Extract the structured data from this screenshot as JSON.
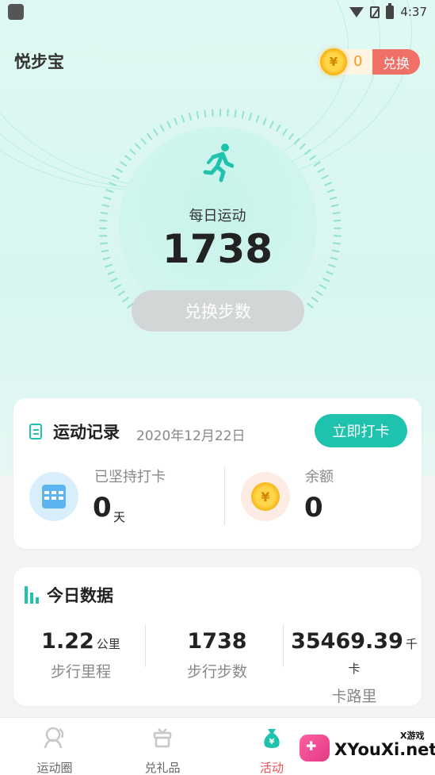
{
  "status_bar": {
    "time": "4:37"
  },
  "header": {
    "app_title": "悦步宝",
    "coin_count": "0",
    "exchange_label": "兑换",
    "coin_symbol": "¥"
  },
  "hero": {
    "label": "每日运动",
    "steps": "1738",
    "button_label": "兑换步数"
  },
  "record_card": {
    "title": "运动记录",
    "date": "2020年12月22日",
    "checkin_label": "立即打卡",
    "streak_label": "已坚持打卡",
    "streak_value": "0",
    "streak_unit": "天",
    "balance_label": "余额",
    "balance_value": "0",
    "coin_symbol": "¥"
  },
  "today_card": {
    "title": "今日数据",
    "stats": [
      {
        "value": "1.22",
        "unit": "公里",
        "label": "步行里程"
      },
      {
        "value": "1738",
        "unit": "",
        "label": "步行步数"
      },
      {
        "value": "35469.39",
        "unit": "千卡",
        "label": "卡路里"
      }
    ]
  },
  "tabbar": {
    "items": [
      {
        "label": "运动圈",
        "active": false
      },
      {
        "label": "兑礼品",
        "active": false
      },
      {
        "label": "活动",
        "active": true
      }
    ]
  },
  "watermark": {
    "text": "XYouXi.net",
    "sub": "X游戏"
  },
  "colors": {
    "accent": "#1fc3ad",
    "exchange": "#f07068",
    "active_tab": "#f05050",
    "coin": "#f6b00b"
  }
}
